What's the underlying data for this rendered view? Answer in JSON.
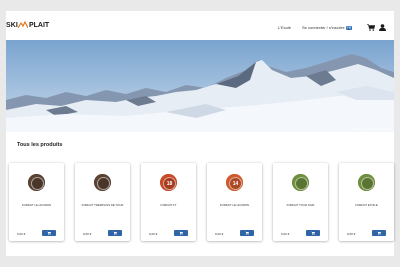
{
  "header": {
    "logo_left": "SKI",
    "logo_right": "PLAIT",
    "nav_link_1": "L'Ecole",
    "nav_link_2": "Se connecter / s'inscrire",
    "nav_badge": "FR"
  },
  "hero": {
    "credit": "Photo : Ski Plait / Mont Blanc"
  },
  "section": {
    "title": "Tous les produits"
  },
  "products": [
    {
      "name": "FORFAIT LE HOURON",
      "price": "9,00 €",
      "badge": "",
      "color": "#5b4333"
    },
    {
      "name": "FORFAIT TREMPLINS DE TOUR",
      "price": "9,00 €",
      "badge": "",
      "color": "#5b4333"
    },
    {
      "name": "FORFAIT FT",
      "price": "9,00 €",
      "badge": "18",
      "color": "#c84a26"
    },
    {
      "name": "FORFAIT LE HOURON",
      "price": "9,00 €",
      "badge": "14",
      "color": "#d05a2c"
    },
    {
      "name": "FORFAIT TOUR NIVE",
      "price": "9,00 €",
      "badge": "",
      "color": "#6e8f3c"
    },
    {
      "name": "FORFAIT ETOILE",
      "price": "9,00 €",
      "badge": "",
      "color": "#6e8f3c"
    }
  ],
  "colors": {
    "accent": "#2f65a7",
    "background": "#e9e9e9"
  }
}
